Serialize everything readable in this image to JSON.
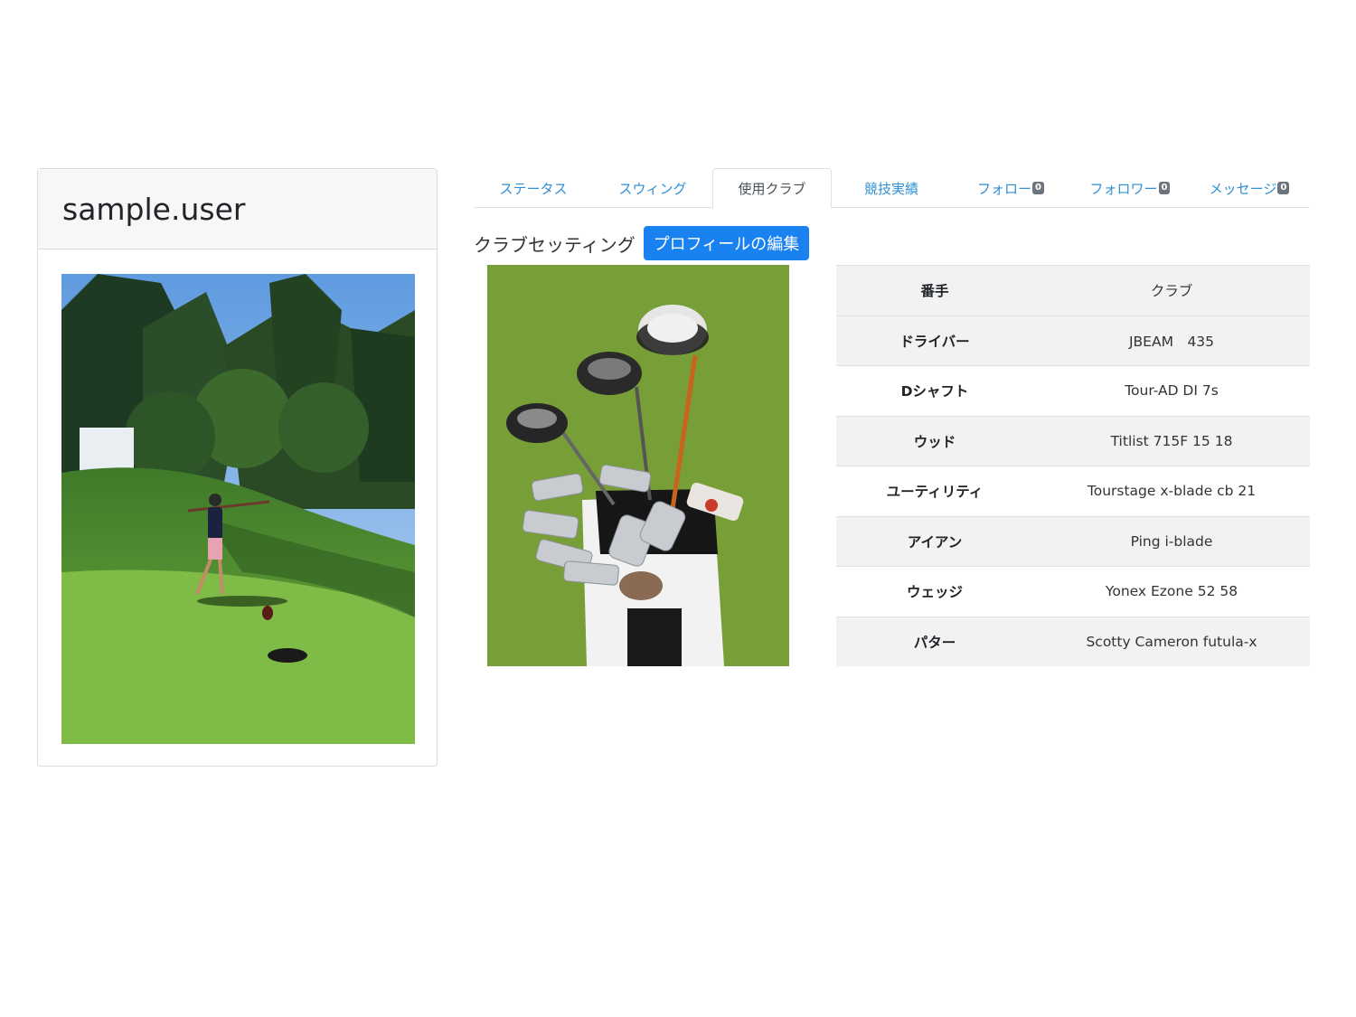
{
  "profile": {
    "username": "sample.user"
  },
  "tabs": [
    {
      "label": "ステータス",
      "badge": null
    },
    {
      "label": "スウィング",
      "badge": null
    },
    {
      "label": "使用クラブ",
      "badge": null,
      "active": true
    },
    {
      "label": "競技実績",
      "badge": null
    },
    {
      "label": "フォロー",
      "badge": "0"
    },
    {
      "label": "フォロワー",
      "badge": "0"
    },
    {
      "label": "メッセージ",
      "badge": "0"
    }
  ],
  "club_setting": {
    "title": "クラブセッティング",
    "edit_button": "プロフィールの編集",
    "table": {
      "headers": [
        "番手",
        "クラブ"
      ],
      "rows": [
        [
          "ドライバー",
          "JBEAM　435"
        ],
        [
          "Dシャフト",
          "Tour-AD DI 7s"
        ],
        [
          "ウッド",
          "Titlist 715F 15 18"
        ],
        [
          "ユーティリティ",
          "Tourstage x-blade cb 21"
        ],
        [
          "アイアン",
          "Ping i-blade"
        ],
        [
          "ウェッジ",
          "Yonex Ezone 52 58"
        ],
        [
          "パター",
          "Scotty Cameron futula-x"
        ]
      ]
    }
  },
  "colors": {
    "link": "#2f8fd2",
    "primary_button": "#1a82f0",
    "badge": "#6c757d",
    "striped_row": "#f2f2f2"
  }
}
